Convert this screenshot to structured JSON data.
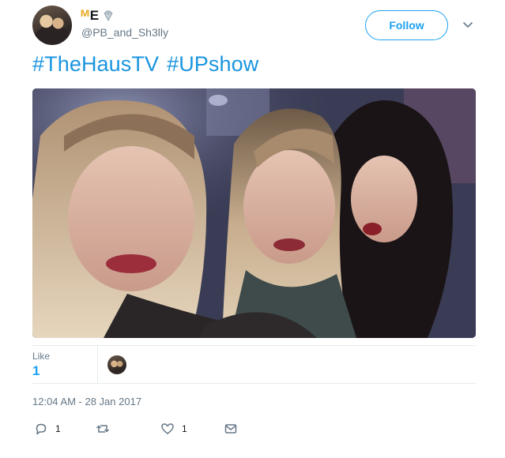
{
  "user": {
    "name_part1": "ᴹ",
    "name_part2": "E",
    "name_emoji": "gem-icon",
    "handle": "@PB_and_Sh3lly"
  },
  "header": {
    "follow_label": "Follow",
    "menu_icon": "chevron-down-icon"
  },
  "tweet": {
    "hashtags": [
      "#TheHausTV",
      "#UPshow"
    ],
    "photo_description": "",
    "timestamp": "12:04 AM - 28 Jan 2017"
  },
  "stats": {
    "likes_label": "Like",
    "likes_count": "1"
  },
  "actions": {
    "reply_count": "1",
    "retweet_count": "",
    "like_count": "1"
  },
  "colors": {
    "accent": "#1da1f2",
    "hashtag": "#1b95e0",
    "muted": "#657786",
    "name_m": "#e8a91c"
  }
}
